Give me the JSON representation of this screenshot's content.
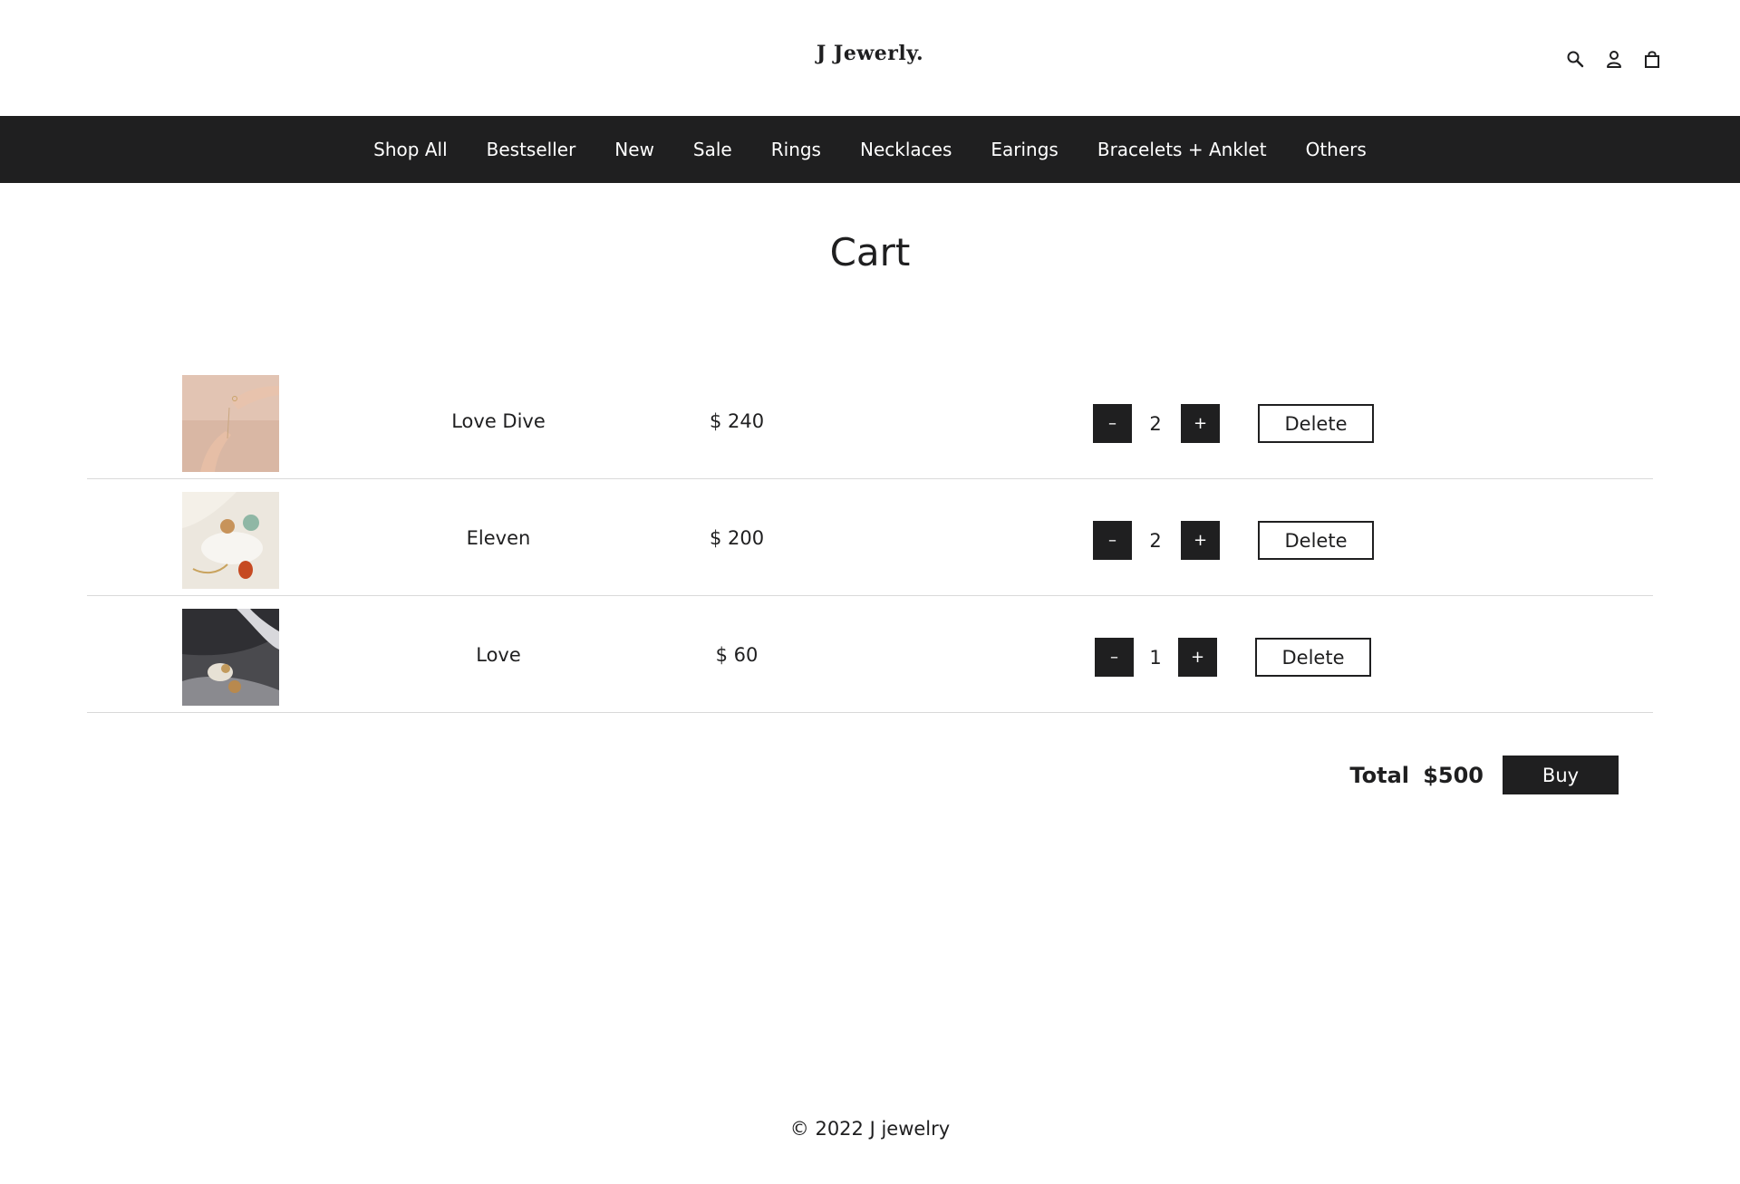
{
  "brand": {
    "logo": "J Jewerly."
  },
  "header_icons": [
    "search-icon",
    "user-icon",
    "bag-icon"
  ],
  "nav": {
    "items": [
      "Shop All",
      "Bestseller",
      "New",
      "Sale",
      "Rings",
      "Necklaces",
      "Earings",
      "Bracelets + Anklet",
      "Others"
    ]
  },
  "page": {
    "title": "Cart"
  },
  "cart": {
    "items": [
      {
        "name": "Love Dive",
        "price": "$ 240",
        "qty": "2",
        "minus": "–",
        "plus": "+",
        "delete": "Delete"
      },
      {
        "name": "Eleven",
        "price": "$ 200",
        "qty": "2",
        "minus": "–",
        "plus": "+",
        "delete": "Delete"
      },
      {
        "name": "Love",
        "price": "$ 60",
        "qty": "1",
        "minus": "–",
        "plus": "+",
        "delete": "Delete"
      }
    ],
    "total_label": "Total",
    "total_value": "$500",
    "buy_label": "Buy"
  },
  "footer": {
    "text": "© 2022 J jewelry"
  },
  "colors": {
    "dark": "#1f1f20",
    "background": "#ffffff",
    "divider": "#d9d9d9"
  }
}
